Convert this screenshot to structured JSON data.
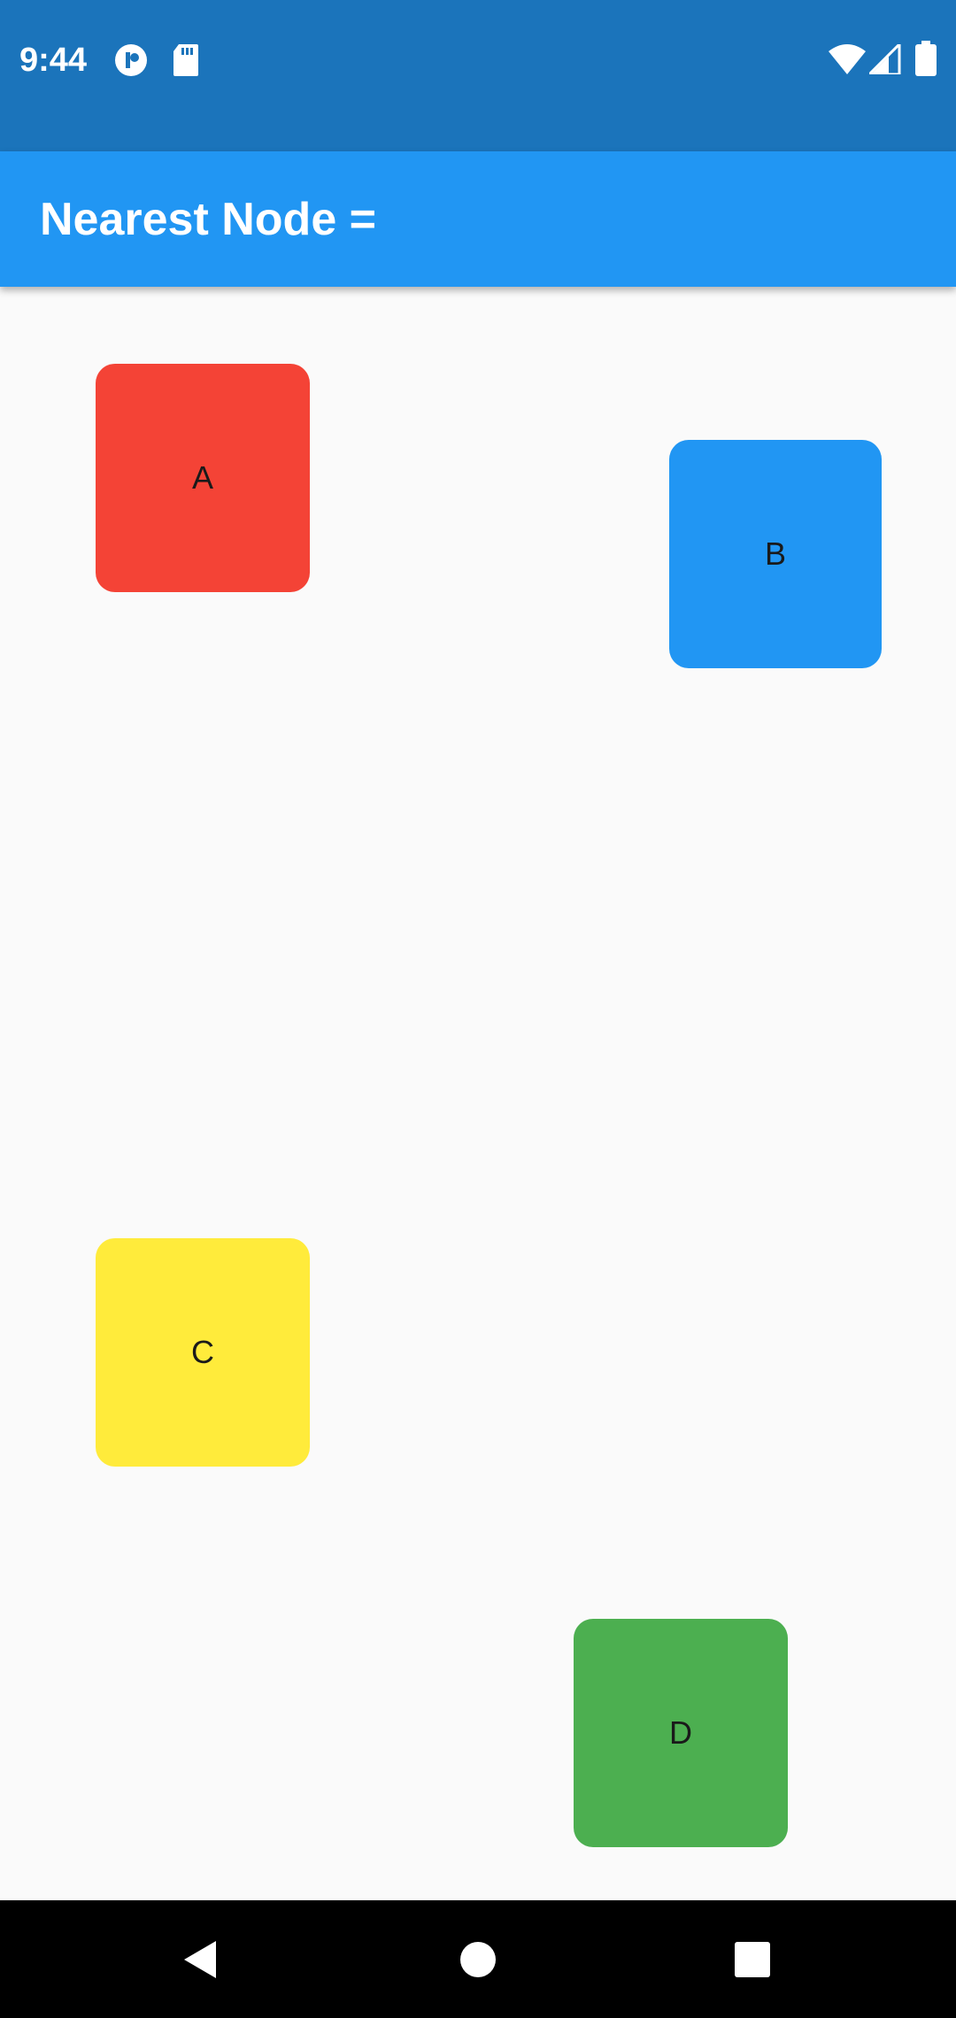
{
  "status_bar": {
    "time": "9:44",
    "icons_left": [
      "app-notification-icon",
      "sd-card-icon"
    ],
    "icons_right": [
      "wifi-icon",
      "cell-signal-icon",
      "battery-icon"
    ],
    "background": "#1b74bb"
  },
  "app_bar": {
    "title": "Nearest Node =",
    "background": "#2196f3"
  },
  "nodes": [
    {
      "label": "A",
      "color": "#f44336"
    },
    {
      "label": "B",
      "color": "#2196f3"
    },
    {
      "label": "C",
      "color": "#ffeb3b"
    },
    {
      "label": "D",
      "color": "#4caf50"
    }
  ],
  "nav_bar": {
    "buttons": [
      "back-icon",
      "home-icon",
      "recents-icon"
    ]
  }
}
